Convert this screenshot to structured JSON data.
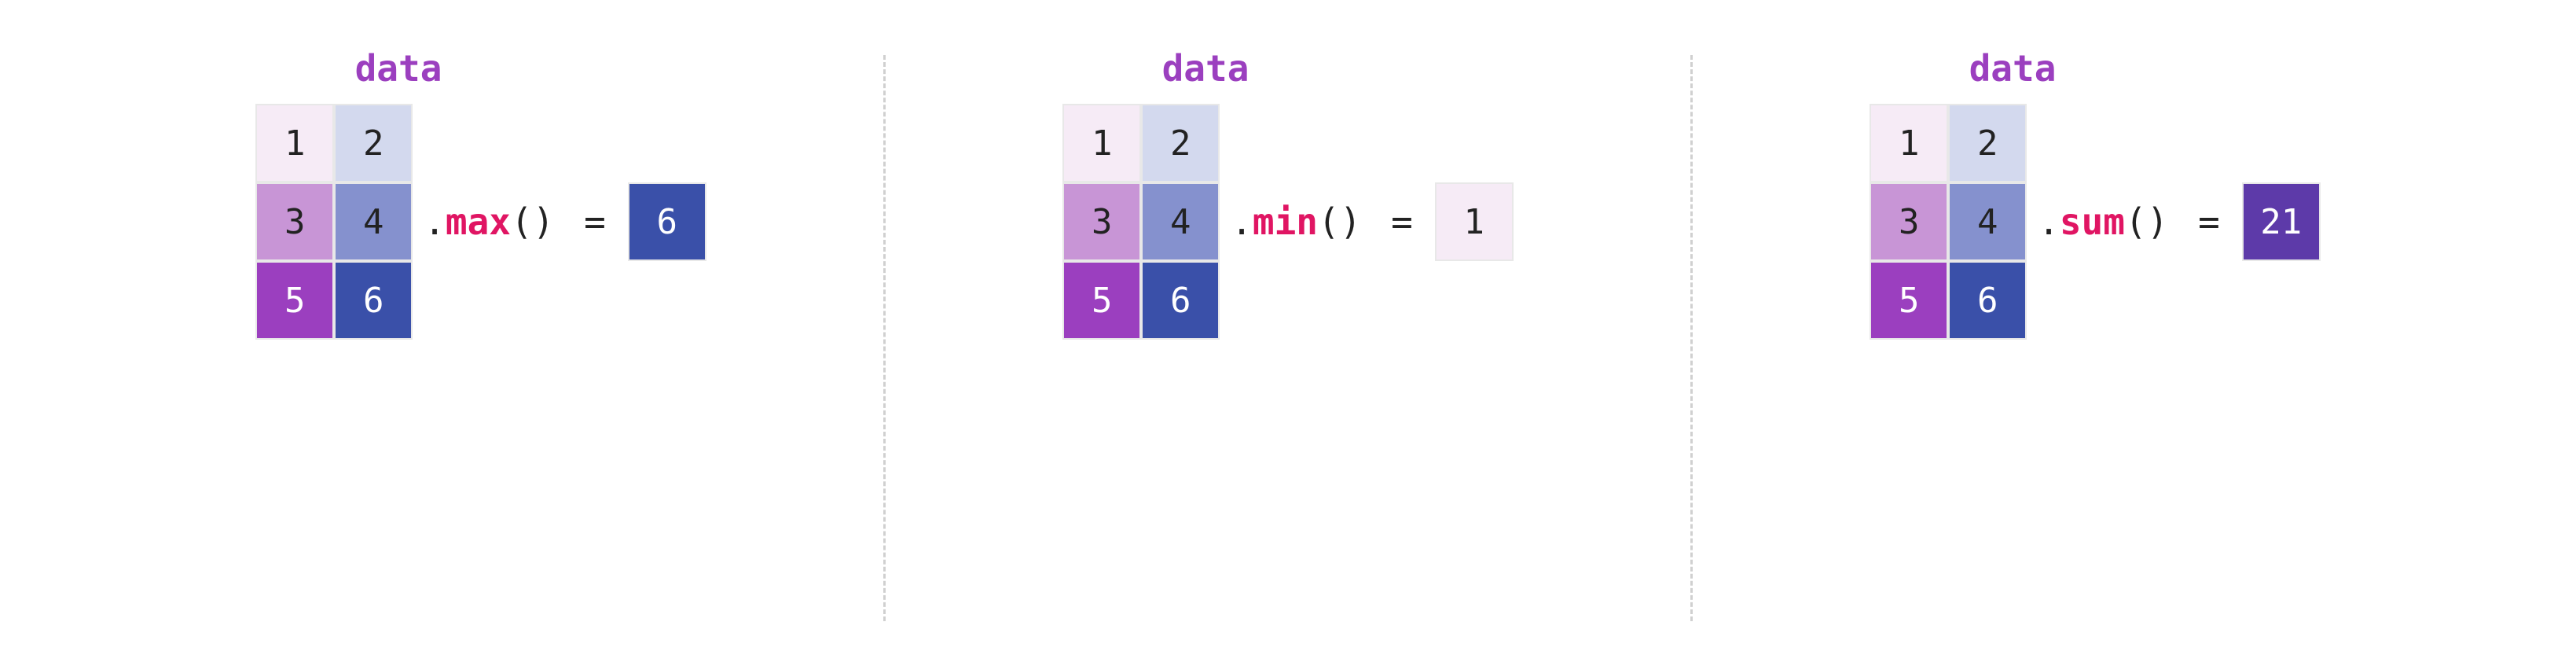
{
  "panels": [
    {
      "title": "data",
      "grid": [
        [
          {
            "v": "1",
            "bg": "#f6ebf6",
            "fg": "#222"
          },
          {
            "v": "2",
            "bg": "#d3d9ee",
            "fg": "#222"
          }
        ],
        [
          {
            "v": "3",
            "bg": "#c895d6",
            "fg": "#222"
          },
          {
            "v": "4",
            "bg": "#8591ce",
            "fg": "#222"
          }
        ],
        [
          {
            "v": "5",
            "bg": "#9b3fbf",
            "fg": "#fff"
          },
          {
            "v": "6",
            "bg": "#3a50a9",
            "fg": "#fff"
          }
        ]
      ],
      "fn": "max",
      "result": {
        "v": "6",
        "bg": "#3a50a9",
        "fg": "#fff"
      }
    },
    {
      "title": "data",
      "grid": [
        [
          {
            "v": "1",
            "bg": "#f6ebf6",
            "fg": "#222"
          },
          {
            "v": "2",
            "bg": "#d3d9ee",
            "fg": "#222"
          }
        ],
        [
          {
            "v": "3",
            "bg": "#c895d6",
            "fg": "#222"
          },
          {
            "v": "4",
            "bg": "#8591ce",
            "fg": "#222"
          }
        ],
        [
          {
            "v": "5",
            "bg": "#9b3fbf",
            "fg": "#fff"
          },
          {
            "v": "6",
            "bg": "#3a50a9",
            "fg": "#fff"
          }
        ]
      ],
      "fn": "min",
      "result": {
        "v": "1",
        "bg": "#f6ebf6",
        "fg": "#222"
      }
    },
    {
      "title": "data",
      "grid": [
        [
          {
            "v": "1",
            "bg": "#f6ebf6",
            "fg": "#222"
          },
          {
            "v": "2",
            "bg": "#d3d9ee",
            "fg": "#222"
          }
        ],
        [
          {
            "v": "3",
            "bg": "#c895d6",
            "fg": "#222"
          },
          {
            "v": "4",
            "bg": "#8591ce",
            "fg": "#222"
          }
        ],
        [
          {
            "v": "5",
            "bg": "#9b3fbf",
            "fg": "#fff"
          },
          {
            "v": "6",
            "bg": "#3a50a9",
            "fg": "#fff"
          }
        ]
      ],
      "fn": "sum",
      "result": {
        "v": "21",
        "bg": "#5d3aa9",
        "fg": "#fff"
      }
    }
  ],
  "syntax": {
    "dot": ".",
    "open": "(",
    "close": ")",
    "equals": " ="
  }
}
